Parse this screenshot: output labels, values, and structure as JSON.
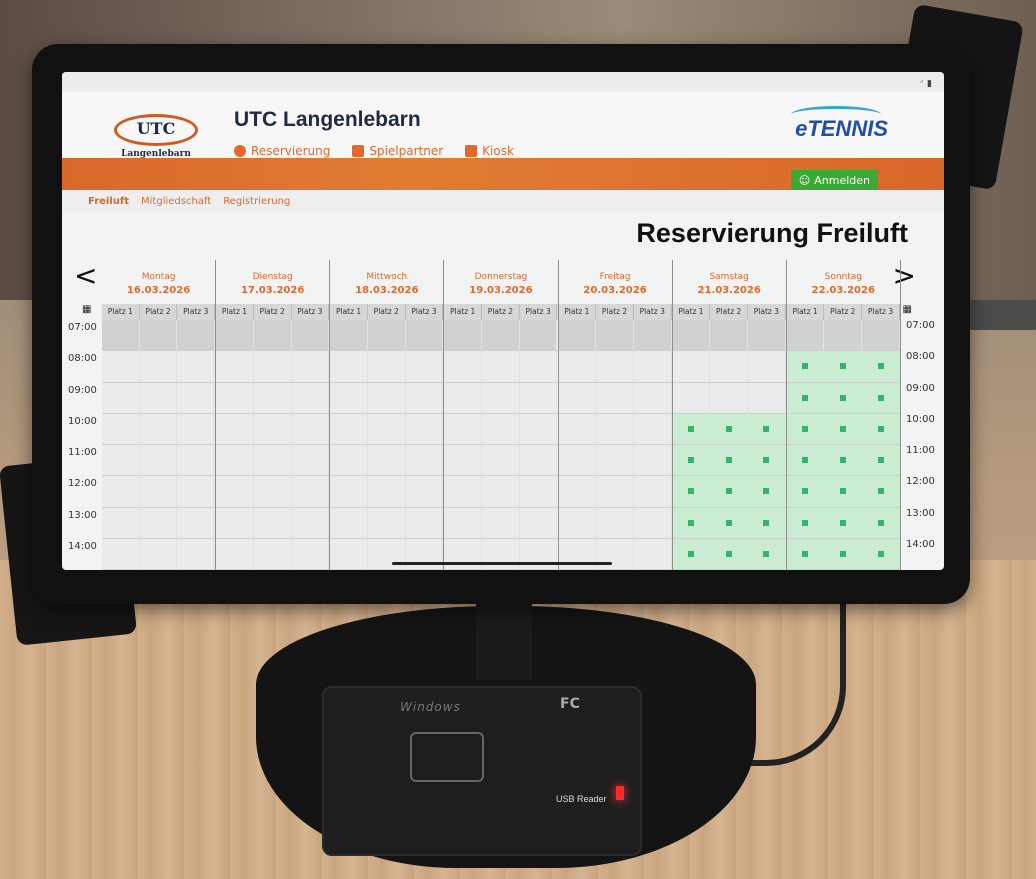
{
  "status_bar": {
    "system_icons": "⸍ ▮"
  },
  "header": {
    "logo_text": "UTC",
    "logo_subtext": "Langenlebarn",
    "club_title": "UTC Langenlebarn",
    "brand": "eTENNIS",
    "nav": [
      {
        "label": "Reservierung",
        "icon": "clock-icon"
      },
      {
        "label": "Spielpartner",
        "icon": "handshake-icon"
      },
      {
        "label": "Kiosk",
        "icon": "kiosk-icon"
      }
    ],
    "login_label": "Anmelden"
  },
  "subnav": [
    "Freiluft",
    "Mitgliedschaft",
    "Registrierung"
  ],
  "page_title": "Reservierung Freiluft",
  "calendar": {
    "prev": "<",
    "next": ">",
    "days": [
      {
        "name": "Montag",
        "date": "16.03.2026"
      },
      {
        "name": "Dienstag",
        "date": "17.03.2026"
      },
      {
        "name": "Mittwoch",
        "date": "18.03.2026"
      },
      {
        "name": "Donnerstag",
        "date": "19.03.2026"
      },
      {
        "name": "Freitag",
        "date": "20.03.2026"
      },
      {
        "name": "Samstag",
        "date": "21.03.2026"
      },
      {
        "name": "Sonntag",
        "date": "22.03.2026"
      }
    ],
    "courts": [
      "Platz 1",
      "Platz 2",
      "Platz 3"
    ],
    "times_left": [
      "07:00",
      "08:00",
      "09:00",
      "10:00",
      "11:00",
      "12:00",
      "13:00",
      "14:00"
    ],
    "times_right": [
      "07:00",
      "08:00",
      "09:00",
      "10:00",
      "11:00",
      "12:00",
      "13:00",
      "14:00"
    ],
    "free_slots_by_day": [
      [],
      [],
      [],
      [],
      [],
      [
        3,
        4,
        5,
        6,
        7
      ],
      [
        1,
        2,
        3,
        4,
        5,
        6,
        7
      ]
    ],
    "colors": {
      "free": "#c9ecd2",
      "free_marker": "#35b56a",
      "past": "#d0d1d1",
      "accent": "#e2682e"
    }
  },
  "reader": {
    "brand": "Windows",
    "cert": "FC",
    "label": "USB Reader"
  }
}
